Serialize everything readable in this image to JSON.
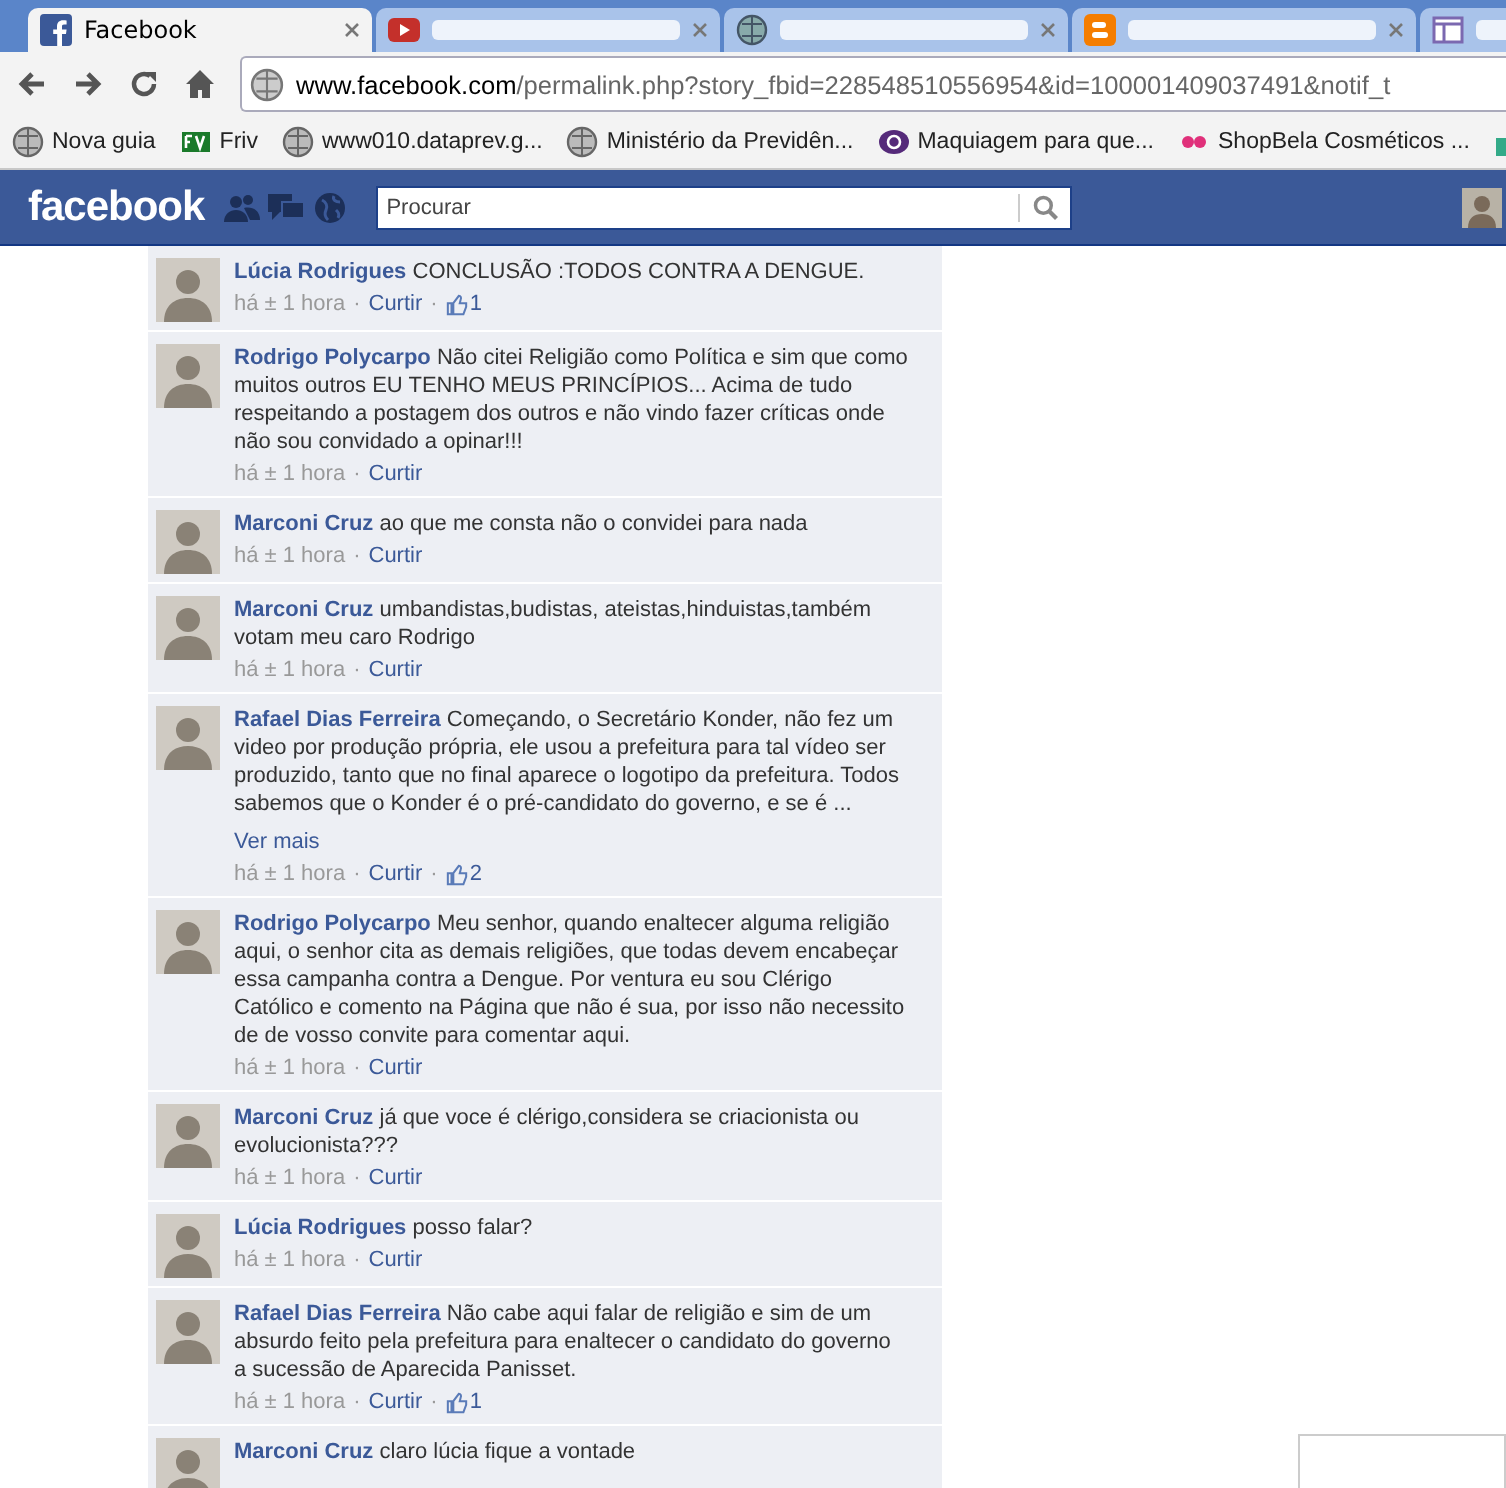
{
  "browser": {
    "tabs": [
      {
        "title": "Facebook",
        "selected": true
      },
      {
        "selected": false
      },
      {
        "selected": false
      },
      {
        "selected": false
      },
      {
        "selected": false
      }
    ],
    "url": {
      "host": "www.facebook.com",
      "path": "/permalink.php?story_fbid=228548510556954&id=100001409037491&notif_t"
    },
    "bookmarks": [
      {
        "label": "Nova guia"
      },
      {
        "label": "Friv"
      },
      {
        "label": "www010.dataprev.g..."
      },
      {
        "label": "Ministério da Previdên..."
      },
      {
        "label": "Maquiagem para que..."
      },
      {
        "label": "ShopBela Cosméticos ..."
      }
    ]
  },
  "header": {
    "logo": "facebook",
    "search_placeholder": "Procurar"
  },
  "comments": [
    {
      "author": "Lúcia Rodrigues",
      "text": "CONCLUSÃO :TODOS CONTRA A DENGUE.",
      "time": "há ± 1 hora",
      "sep_1": "·",
      "action": "Curtir",
      "sep_2": "·",
      "likes": "1"
    },
    {
      "author": "Rodrigo Polycarpo",
      "text": "Não citei Religião como Política e sim que como muitos outros EU TENHO MEUS PRINCÍPIOS... Acima de tudo respeitando a postagem dos outros e não vindo fazer críticas onde não sou convidado a opinar!!!",
      "time": "há ± 1 hora",
      "sep_1": "·",
      "action": "Curtir"
    },
    {
      "author": "Marconi Cruz",
      "text": "ao que me consta não o convidei para nada",
      "time": "há ± 1 hora",
      "sep_1": "·",
      "action": "Curtir"
    },
    {
      "author": "Marconi Cruz",
      "text": "umbandistas,budistas, ateistas,hinduistas,também votam meu caro Rodrigo",
      "time": "há ± 1 hora",
      "sep_1": "·",
      "action": "Curtir"
    },
    {
      "author": "Rafael Dias Ferreira",
      "text": "Começando, o Secretário Konder, não fez um video por produção própria, ele usou a prefeitura para tal vídeo ser produzido, tanto que no final aparece o logotipo da prefeitura. Todos sabemos que o Konder é o pré-candidato do governo, e se é ...",
      "more": "Ver mais",
      "time": "há ± 1 hora",
      "sep_1": "·",
      "action": "Curtir",
      "sep_2": "·",
      "likes": "2"
    },
    {
      "author": "Rodrigo Polycarpo",
      "text": "Meu senhor, quando enaltecer alguma religião aqui, o senhor cita as demais religiões, que todas devem encabeçar essa campanha contra a Dengue. Por ventura eu sou Clérigo Católico e comento na Página que não é sua, por isso não necessito de de vosso convite para comentar aqui.",
      "time": "há ± 1 hora",
      "sep_1": "·",
      "action": "Curtir"
    },
    {
      "author": "Marconi Cruz",
      "text": "já que voce é clérigo,considera se criacionista ou evolucionista???",
      "time": "há ± 1 hora",
      "sep_1": "·",
      "action": "Curtir"
    },
    {
      "author": "Lúcia Rodrigues",
      "text": "posso falar?",
      "time": "há ± 1 hora",
      "sep_1": "·",
      "action": "Curtir"
    },
    {
      "author": "Rafael Dias Ferreira",
      "text": "Não cabe aqui falar de religião e sim de um absurdo feito pela prefeitura para enaltecer o candidato do governo a sucessão de Aparecida Panisset.",
      "time": "há ± 1 hora",
      "sep_1": "·",
      "action": "Curtir",
      "sep_2": "·",
      "likes": "1"
    },
    {
      "author": "Marconi Cruz",
      "text": "claro lúcia fique a vontade"
    }
  ]
}
